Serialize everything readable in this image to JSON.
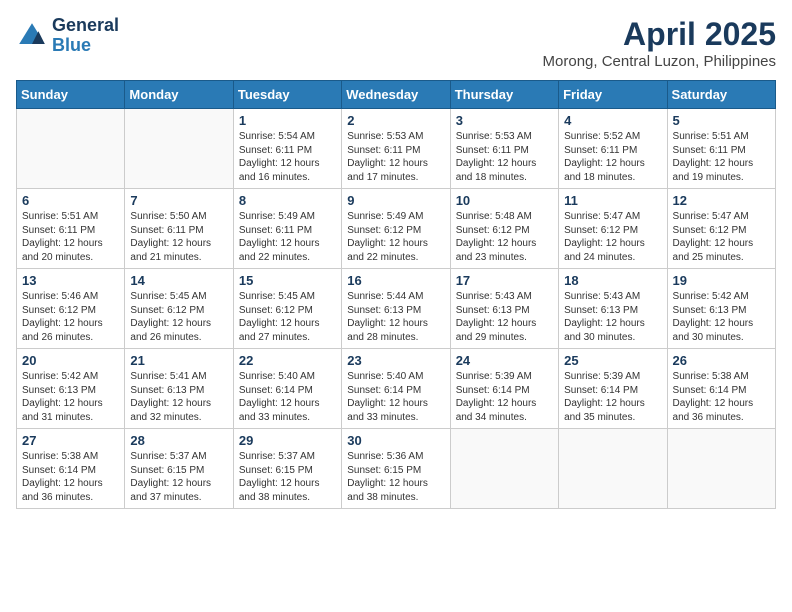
{
  "header": {
    "logo_general": "General",
    "logo_blue": "Blue",
    "title": "April 2025",
    "location": "Morong, Central Luzon, Philippines"
  },
  "days_of_week": [
    "Sunday",
    "Monday",
    "Tuesday",
    "Wednesday",
    "Thursday",
    "Friday",
    "Saturday"
  ],
  "weeks": [
    [
      {
        "day": "",
        "info": ""
      },
      {
        "day": "",
        "info": ""
      },
      {
        "day": "1",
        "info": "Sunrise: 5:54 AM\nSunset: 6:11 PM\nDaylight: 12 hours and 16 minutes."
      },
      {
        "day": "2",
        "info": "Sunrise: 5:53 AM\nSunset: 6:11 PM\nDaylight: 12 hours and 17 minutes."
      },
      {
        "day": "3",
        "info": "Sunrise: 5:53 AM\nSunset: 6:11 PM\nDaylight: 12 hours and 18 minutes."
      },
      {
        "day": "4",
        "info": "Sunrise: 5:52 AM\nSunset: 6:11 PM\nDaylight: 12 hours and 18 minutes."
      },
      {
        "day": "5",
        "info": "Sunrise: 5:51 AM\nSunset: 6:11 PM\nDaylight: 12 hours and 19 minutes."
      }
    ],
    [
      {
        "day": "6",
        "info": "Sunrise: 5:51 AM\nSunset: 6:11 PM\nDaylight: 12 hours and 20 minutes."
      },
      {
        "day": "7",
        "info": "Sunrise: 5:50 AM\nSunset: 6:11 PM\nDaylight: 12 hours and 21 minutes."
      },
      {
        "day": "8",
        "info": "Sunrise: 5:49 AM\nSunset: 6:11 PM\nDaylight: 12 hours and 22 minutes."
      },
      {
        "day": "9",
        "info": "Sunrise: 5:49 AM\nSunset: 6:12 PM\nDaylight: 12 hours and 22 minutes."
      },
      {
        "day": "10",
        "info": "Sunrise: 5:48 AM\nSunset: 6:12 PM\nDaylight: 12 hours and 23 minutes."
      },
      {
        "day": "11",
        "info": "Sunrise: 5:47 AM\nSunset: 6:12 PM\nDaylight: 12 hours and 24 minutes."
      },
      {
        "day": "12",
        "info": "Sunrise: 5:47 AM\nSunset: 6:12 PM\nDaylight: 12 hours and 25 minutes."
      }
    ],
    [
      {
        "day": "13",
        "info": "Sunrise: 5:46 AM\nSunset: 6:12 PM\nDaylight: 12 hours and 26 minutes."
      },
      {
        "day": "14",
        "info": "Sunrise: 5:45 AM\nSunset: 6:12 PM\nDaylight: 12 hours and 26 minutes."
      },
      {
        "day": "15",
        "info": "Sunrise: 5:45 AM\nSunset: 6:12 PM\nDaylight: 12 hours and 27 minutes."
      },
      {
        "day": "16",
        "info": "Sunrise: 5:44 AM\nSunset: 6:13 PM\nDaylight: 12 hours and 28 minutes."
      },
      {
        "day": "17",
        "info": "Sunrise: 5:43 AM\nSunset: 6:13 PM\nDaylight: 12 hours and 29 minutes."
      },
      {
        "day": "18",
        "info": "Sunrise: 5:43 AM\nSunset: 6:13 PM\nDaylight: 12 hours and 30 minutes."
      },
      {
        "day": "19",
        "info": "Sunrise: 5:42 AM\nSunset: 6:13 PM\nDaylight: 12 hours and 30 minutes."
      }
    ],
    [
      {
        "day": "20",
        "info": "Sunrise: 5:42 AM\nSunset: 6:13 PM\nDaylight: 12 hours and 31 minutes."
      },
      {
        "day": "21",
        "info": "Sunrise: 5:41 AM\nSunset: 6:13 PM\nDaylight: 12 hours and 32 minutes."
      },
      {
        "day": "22",
        "info": "Sunrise: 5:40 AM\nSunset: 6:14 PM\nDaylight: 12 hours and 33 minutes."
      },
      {
        "day": "23",
        "info": "Sunrise: 5:40 AM\nSunset: 6:14 PM\nDaylight: 12 hours and 33 minutes."
      },
      {
        "day": "24",
        "info": "Sunrise: 5:39 AM\nSunset: 6:14 PM\nDaylight: 12 hours and 34 minutes."
      },
      {
        "day": "25",
        "info": "Sunrise: 5:39 AM\nSunset: 6:14 PM\nDaylight: 12 hours and 35 minutes."
      },
      {
        "day": "26",
        "info": "Sunrise: 5:38 AM\nSunset: 6:14 PM\nDaylight: 12 hours and 36 minutes."
      }
    ],
    [
      {
        "day": "27",
        "info": "Sunrise: 5:38 AM\nSunset: 6:14 PM\nDaylight: 12 hours and 36 minutes."
      },
      {
        "day": "28",
        "info": "Sunrise: 5:37 AM\nSunset: 6:15 PM\nDaylight: 12 hours and 37 minutes."
      },
      {
        "day": "29",
        "info": "Sunrise: 5:37 AM\nSunset: 6:15 PM\nDaylight: 12 hours and 38 minutes."
      },
      {
        "day": "30",
        "info": "Sunrise: 5:36 AM\nSunset: 6:15 PM\nDaylight: 12 hours and 38 minutes."
      },
      {
        "day": "",
        "info": ""
      },
      {
        "day": "",
        "info": ""
      },
      {
        "day": "",
        "info": ""
      }
    ]
  ]
}
